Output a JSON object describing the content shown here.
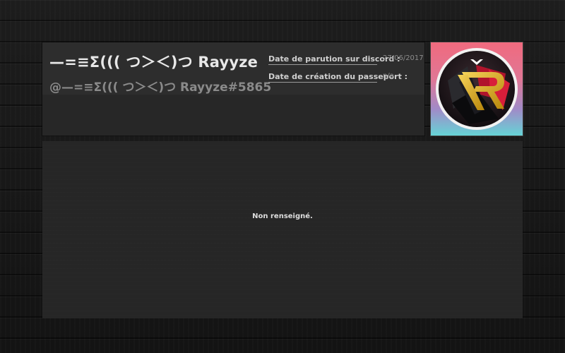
{
  "profile": {
    "display_name": "—=≡Σ((( つ＞＜)つ Rayyze",
    "handle": "@—=≡Σ((( つ＞＜)つ Rayyze#5865",
    "discord_date_label": "Date de parution sur discord :",
    "discord_date_value": "27/06/2017",
    "passport_date_label": "Date de création du passeport :",
    "passport_date_value": "n/a",
    "avatar_icon": "rayyze-r-logo-icon"
  },
  "bio": {
    "text": "Non renseigné."
  },
  "colors": {
    "background": "#161616",
    "card": "#272727",
    "avatar_gradient_top": "#f06a7e",
    "avatar_gradient_bottom": "#66d4d6",
    "logo_gold": "#e0b430",
    "logo_red": "#c8102e"
  }
}
